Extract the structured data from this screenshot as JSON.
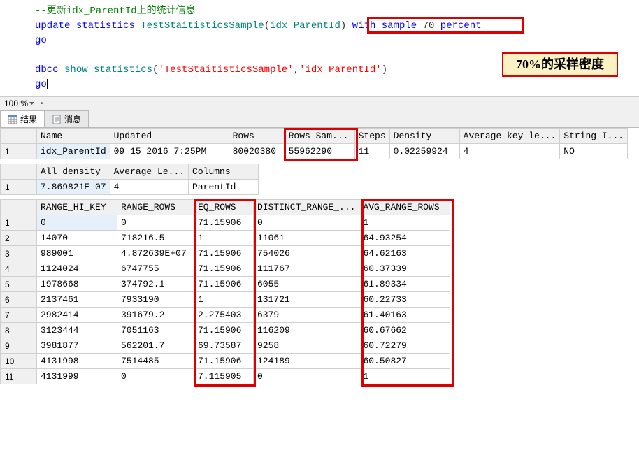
{
  "sql": {
    "comment": "--更新idx_ParentId上的统计信息",
    "update_kw": "update",
    "statistics_kw": "statistics",
    "table": "TestStaitisticsSample",
    "open_paren": "(",
    "idx": "idx_ParentId",
    "close_paren": ")",
    "with_kw": "with",
    "sample_kw": "sample",
    "sample_num": "70",
    "percent_kw": "percent",
    "go1": "go",
    "dbcc_kw": "dbcc",
    "show_stats": "show_statistics",
    "open_paren2": "(",
    "str1": "'TestStaitisticsSample'",
    "comma": ",",
    "str2": "'idx_ParentId'",
    "close_paren2": ")",
    "go2": "go"
  },
  "annotation": "70%的采样密度",
  "zoom": {
    "value": "100 %"
  },
  "tabs": {
    "results": "结果",
    "messages": "消息"
  },
  "grid1": {
    "headers": [
      "Name",
      "Updated",
      "Rows",
      "Rows Sam...",
      "Steps",
      "Density",
      "Average key le...",
      "String I..."
    ],
    "row": [
      "idx_ParentId",
      "09 15 2016  7:25PM",
      "80020380",
      "55962290",
      "11",
      "0.02259924",
      "4",
      "NO"
    ],
    "widths": [
      100,
      170,
      80,
      100,
      50,
      100,
      140,
      80
    ]
  },
  "grid2": {
    "headers": [
      "All density",
      "Average Le...",
      "Columns"
    ],
    "row": [
      "7.869821E-07",
      "4",
      "ParentId"
    ],
    "widths": [
      100,
      100,
      100
    ]
  },
  "grid3": {
    "headers": [
      "RANGE_HI_KEY",
      "RANGE_ROWS",
      "EQ_ROWS",
      "DISTINCT_RANGE_...",
      "AVG_RANGE_ROWS"
    ],
    "rows": [
      [
        "0",
        "0",
        "71.15906",
        "0",
        "1"
      ],
      [
        "14070",
        "718216.5",
        "1",
        "11061",
        "64.93254"
      ],
      [
        "989001",
        "4.872639E+07",
        "71.15906",
        "754026",
        "64.62163"
      ],
      [
        "1124024",
        "6747755",
        "71.15906",
        "111767",
        "60.37339"
      ],
      [
        "1978668",
        "374792.1",
        "71.15906",
        "6055",
        "61.89334"
      ],
      [
        "2137461",
        "7933190",
        "1",
        "131721",
        "60.22733"
      ],
      [
        "2982414",
        "391679.2",
        "2.275403",
        "6379",
        "61.40163"
      ],
      [
        "3123444",
        "7051163",
        "71.15906",
        "116209",
        "60.67662"
      ],
      [
        "3981877",
        "562201.7",
        "69.73587",
        "9258",
        "60.72279"
      ],
      [
        "4131998",
        "7514485",
        "71.15906",
        "124189",
        "60.50827"
      ],
      [
        "4131999",
        "0",
        "7.115905",
        "0",
        "1"
      ]
    ],
    "widths": [
      115,
      110,
      85,
      150,
      130
    ]
  },
  "chart_data": {
    "type": "table",
    "title": "SHOW_STATISTICS output for idx_ParentId with 70% sample",
    "stat_header": {
      "Name": "idx_ParentId",
      "Updated": "09 15 2016 7:25PM",
      "Rows": 80020380,
      "Rows Sampled": 55962290,
      "Steps": 11,
      "Density": 0.02259924,
      "Average key length": 4,
      "String Index": "NO"
    },
    "density_vector": {
      "All density": 7.869821e-07,
      "Average Length": 4,
      "Columns": "ParentId"
    },
    "histogram": [
      {
        "RANGE_HI_KEY": 0,
        "RANGE_ROWS": 0,
        "EQ_ROWS": 71.15906,
        "DISTINCT_RANGE_ROWS": 0,
        "AVG_RANGE_ROWS": 1
      },
      {
        "RANGE_HI_KEY": 14070,
        "RANGE_ROWS": 718216.5,
        "EQ_ROWS": 1,
        "DISTINCT_RANGE_ROWS": 11061,
        "AVG_RANGE_ROWS": 64.93254
      },
      {
        "RANGE_HI_KEY": 989001,
        "RANGE_ROWS": 48726390,
        "EQ_ROWS": 71.15906,
        "DISTINCT_RANGE_ROWS": 754026,
        "AVG_RANGE_ROWS": 64.62163
      },
      {
        "RANGE_HI_KEY": 1124024,
        "RANGE_ROWS": 6747755,
        "EQ_ROWS": 71.15906,
        "DISTINCT_RANGE_ROWS": 111767,
        "AVG_RANGE_ROWS": 60.37339
      },
      {
        "RANGE_HI_KEY": 1978668,
        "RANGE_ROWS": 374792.1,
        "EQ_ROWS": 71.15906,
        "DISTINCT_RANGE_ROWS": 6055,
        "AVG_RANGE_ROWS": 61.89334
      },
      {
        "RANGE_HI_KEY": 2137461,
        "RANGE_ROWS": 7933190,
        "EQ_ROWS": 1,
        "DISTINCT_RANGE_ROWS": 131721,
        "AVG_RANGE_ROWS": 60.22733
      },
      {
        "RANGE_HI_KEY": 2982414,
        "RANGE_ROWS": 391679.2,
        "EQ_ROWS": 2.275403,
        "DISTINCT_RANGE_ROWS": 6379,
        "AVG_RANGE_ROWS": 61.40163
      },
      {
        "RANGE_HI_KEY": 3123444,
        "RANGE_ROWS": 7051163,
        "EQ_ROWS": 71.15906,
        "DISTINCT_RANGE_ROWS": 116209,
        "AVG_RANGE_ROWS": 60.67662
      },
      {
        "RANGE_HI_KEY": 3981877,
        "RANGE_ROWS": 562201.7,
        "EQ_ROWS": 69.73587,
        "DISTINCT_RANGE_ROWS": 9258,
        "AVG_RANGE_ROWS": 60.72279
      },
      {
        "RANGE_HI_KEY": 4131998,
        "RANGE_ROWS": 7514485,
        "EQ_ROWS": 71.15906,
        "DISTINCT_RANGE_ROWS": 124189,
        "AVG_RANGE_ROWS": 60.50827
      },
      {
        "RANGE_HI_KEY": 4131999,
        "RANGE_ROWS": 0,
        "EQ_ROWS": 7.115905,
        "DISTINCT_RANGE_ROWS": 0,
        "AVG_RANGE_ROWS": 1
      }
    ]
  }
}
